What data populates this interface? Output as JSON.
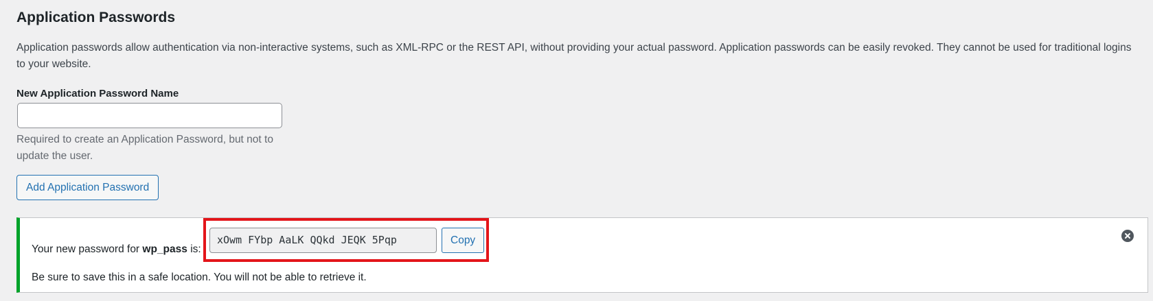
{
  "section": {
    "title": "Application Passwords",
    "description": "Application passwords allow authentication via non-interactive systems, such as XML-RPC or the REST API, without providing your actual password. Application passwords can be easily revoked. They cannot be used for traditional logins to your website."
  },
  "form": {
    "label": "New Application Password Name",
    "input_value": "",
    "help_text": "Required to create an Application Password, but not to update the user.",
    "add_button_label": "Add Application Password"
  },
  "notice": {
    "prefix": "Your new password for ",
    "username": "wp_pass",
    "suffix": " is:",
    "password": "xOwm FYbp AaLK QQkd JEQK 5Pqp",
    "copy_label": "Copy",
    "warning": "Be sure to save this in a safe location. You will not be able to retrieve it.",
    "dismiss_icon": "dismiss-icon"
  },
  "colors": {
    "accent": "#2271b1",
    "success_border": "#00a32a",
    "highlight": "#e3151a"
  }
}
